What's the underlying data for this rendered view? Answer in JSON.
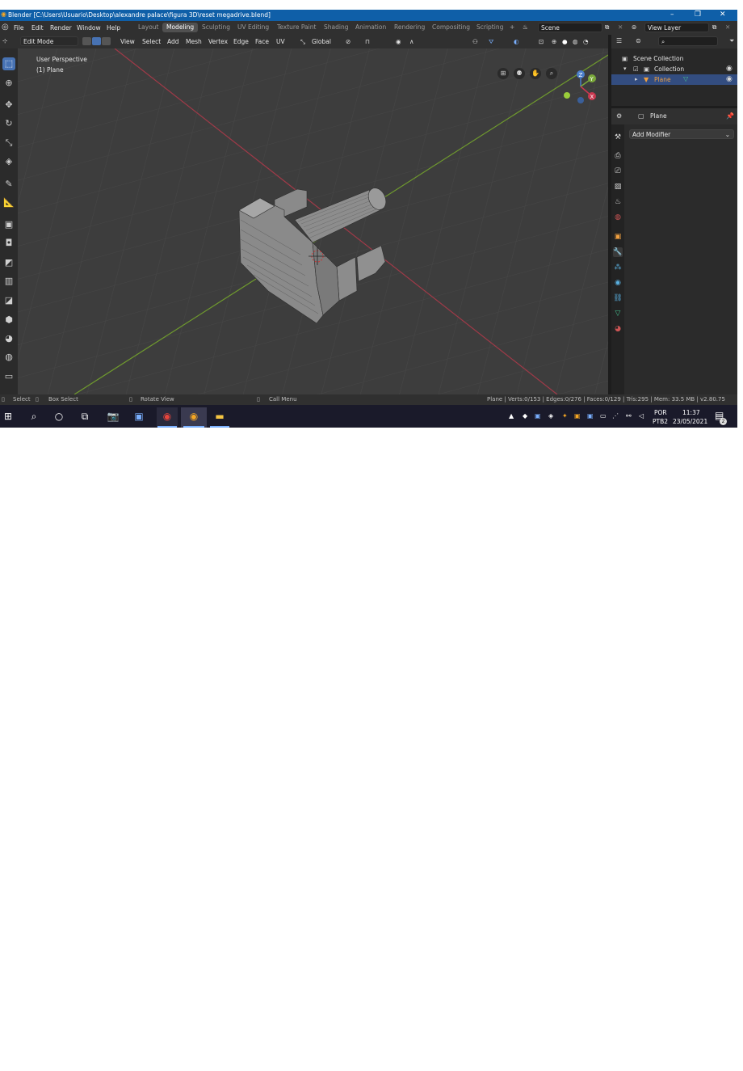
{
  "window": {
    "title": "Blender [C:\\Users\\Usuario\\Desktop\\alexandre palace\\figura 3D\\reset megadrive.blend]",
    "controls": [
      "–",
      "❐",
      "✕"
    ]
  },
  "menu": {
    "items": [
      "File",
      "Edit",
      "Render",
      "Window",
      "Help"
    ],
    "tabs": [
      "Layout",
      "Modeling",
      "Sculpting",
      "UV Editing",
      "Texture Paint",
      "Shading",
      "Animation",
      "Rendering",
      "Compositing",
      "Scripting"
    ],
    "active_tab": "Modeling",
    "add_tab": "+",
    "scene_label": "Scene",
    "view_layer_label": "View Layer"
  },
  "viewport_header": {
    "mode": "Edit Mode",
    "menus": [
      "View",
      "Select",
      "Add",
      "Mesh",
      "Vertex",
      "Edge",
      "Face",
      "UV"
    ],
    "orientation": "Global"
  },
  "viewport": {
    "perspective_label": "User Perspective",
    "object_label": "(1) Plane",
    "gizmo": {
      "z": "Z",
      "y": "Y",
      "x": "X"
    },
    "colors": {
      "x_axis": "#a03a48",
      "y_axis": "#6f9a2e",
      "bg": "#3d3d3d"
    }
  },
  "outliner": {
    "scene_collection": "Scene Collection",
    "collection": "Collection",
    "object": "Plane"
  },
  "properties": {
    "object_name": "Plane",
    "add_modifier": "Add Modifier"
  },
  "status": {
    "select": "Select",
    "box_select": "Box Select",
    "rotate_view": "Rotate View",
    "call_menu": "Call Menu",
    "stats": "Plane | Verts:0/153 | Edges:0/276 | Faces:0/129 | Tris:295 | Mem: 33.5 MB | v2.80.75"
  },
  "taskbar": {
    "language": "POR",
    "layout": "PTB2",
    "time": "11:37",
    "date": "23/05/2021",
    "notifications": "2"
  }
}
